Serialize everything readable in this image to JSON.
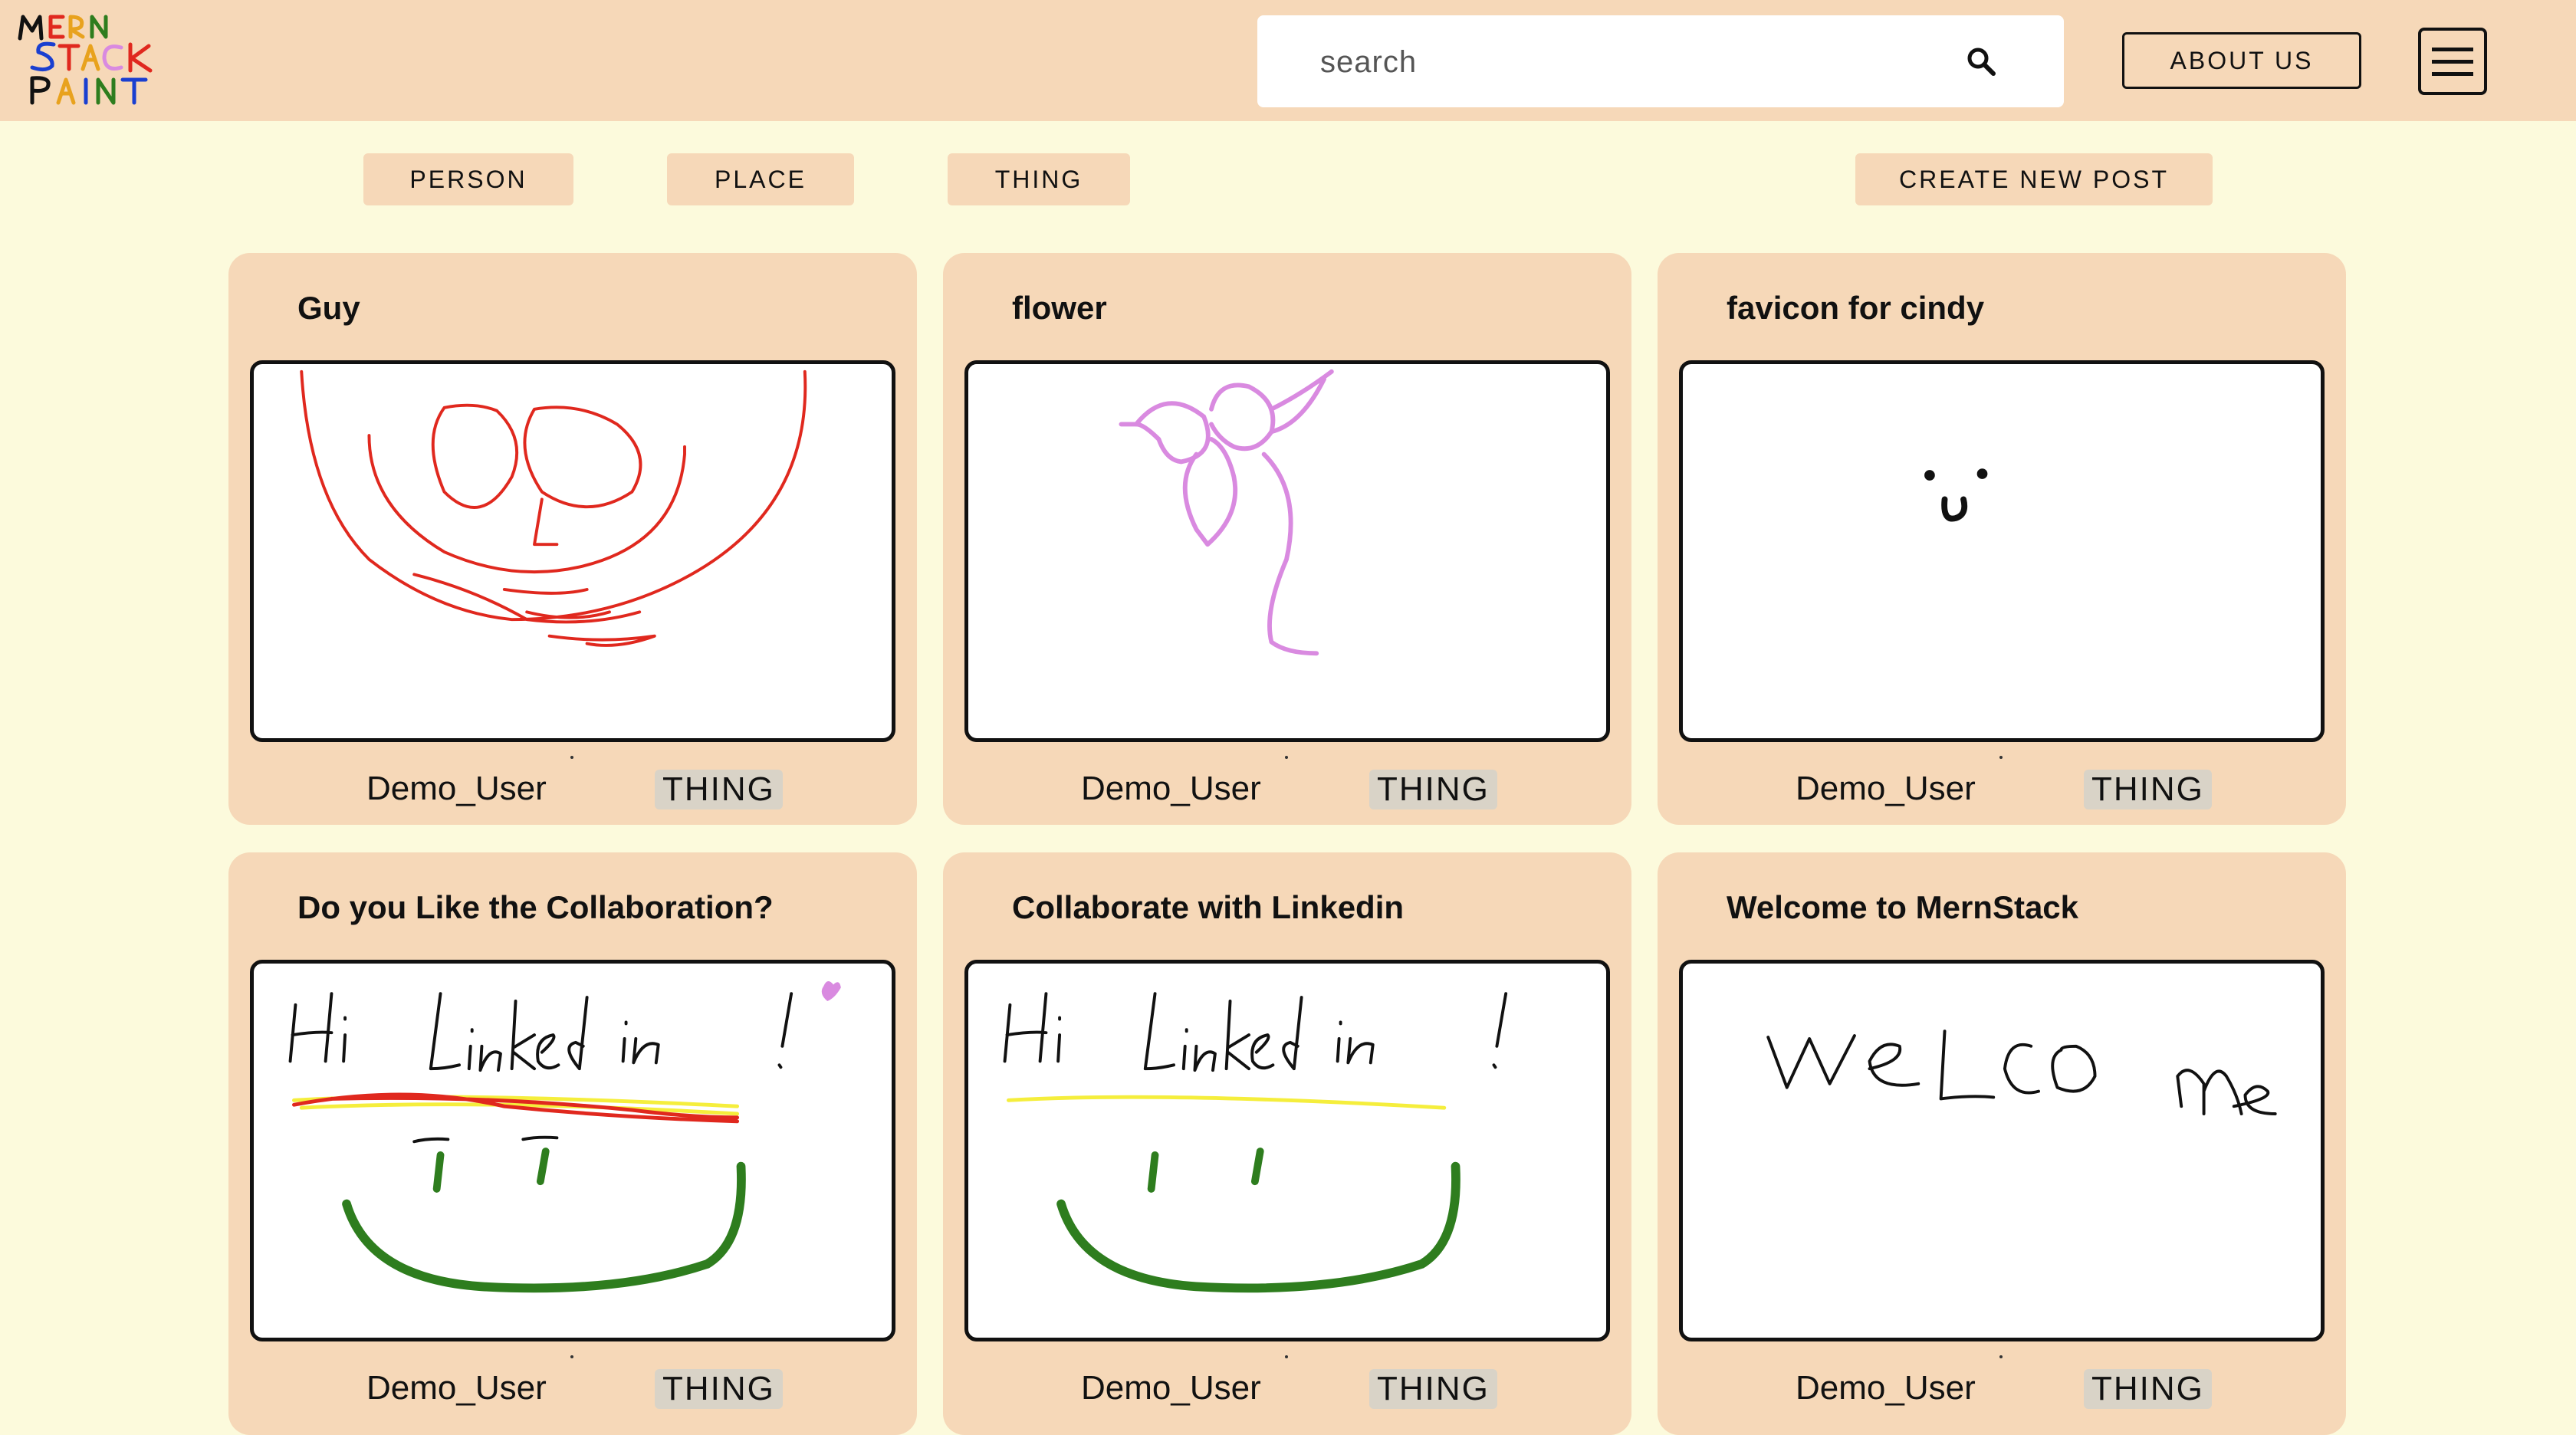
{
  "header": {
    "logo_text": "MERN STACK PAINT",
    "search": {
      "placeholder": "search",
      "value": ""
    },
    "about_label": "ABOUT US",
    "menu_icon": "hamburger-menu-icon"
  },
  "filters": {
    "person": "PERSON",
    "place": "PLACE",
    "thing": "THING",
    "create": "CREATE NEW POST"
  },
  "posts": [
    {
      "title": "Guy",
      "author": "Demo_User",
      "category": "THING"
    },
    {
      "title": "flower",
      "author": "Demo_User",
      "category": "THING"
    },
    {
      "title": "favicon for cindy",
      "author": "Demo_User",
      "category": "THING"
    },
    {
      "title": "Do you Like the Collaboration?",
      "author": "Demo_User",
      "category": "THING"
    },
    {
      "title": "Collaborate with Linkedin",
      "author": "Demo_User",
      "category": "THING"
    },
    {
      "title": "Welcome to MernStack",
      "author": "Demo_User",
      "category": "THING"
    }
  ],
  "drawing_colors": {
    "red": "#e0281e",
    "violet": "#d98ae0",
    "black": "#111111",
    "yellow": "#f5ee3c",
    "green": "#2e7d1e"
  }
}
